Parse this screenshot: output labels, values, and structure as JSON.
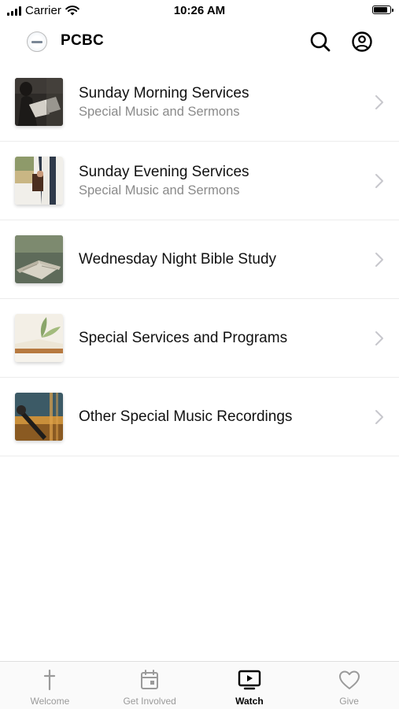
{
  "status_bar": {
    "carrier": "Carrier",
    "time": "10:26 AM",
    "battery_level": 0.9
  },
  "header": {
    "title": "PCBC"
  },
  "services": [
    {
      "title": "Sunday Morning Services",
      "subtitle": "Special Music and Sermons",
      "thumb_icon": "pastor-at-pulpit-image"
    },
    {
      "title": "Sunday Evening Services",
      "subtitle": "Special Music and Sermons",
      "thumb_icon": "man-holding-bible-image"
    },
    {
      "title": "Wednesday Night Bible Study",
      "subtitle": "",
      "thumb_icon": "open-bible-image"
    },
    {
      "title": "Special Services and Programs",
      "subtitle": "",
      "thumb_icon": "open-book-plant-image"
    },
    {
      "title": "Other Special Music Recordings",
      "subtitle": "",
      "thumb_icon": "music-recording-image"
    }
  ],
  "tabs": [
    {
      "label": "Welcome",
      "icon": "cross-icon",
      "active": false
    },
    {
      "label": "Get Involved",
      "icon": "calendar-icon",
      "active": false
    },
    {
      "label": "Watch",
      "icon": "tv-play-icon",
      "active": true
    },
    {
      "label": "Give",
      "icon": "heart-icon",
      "active": false
    }
  ],
  "colors": {
    "active_tab": "#000000",
    "inactive_tab": "#9a9a9a",
    "subtitle": "#8a8a8a",
    "divider": "#ececec"
  }
}
